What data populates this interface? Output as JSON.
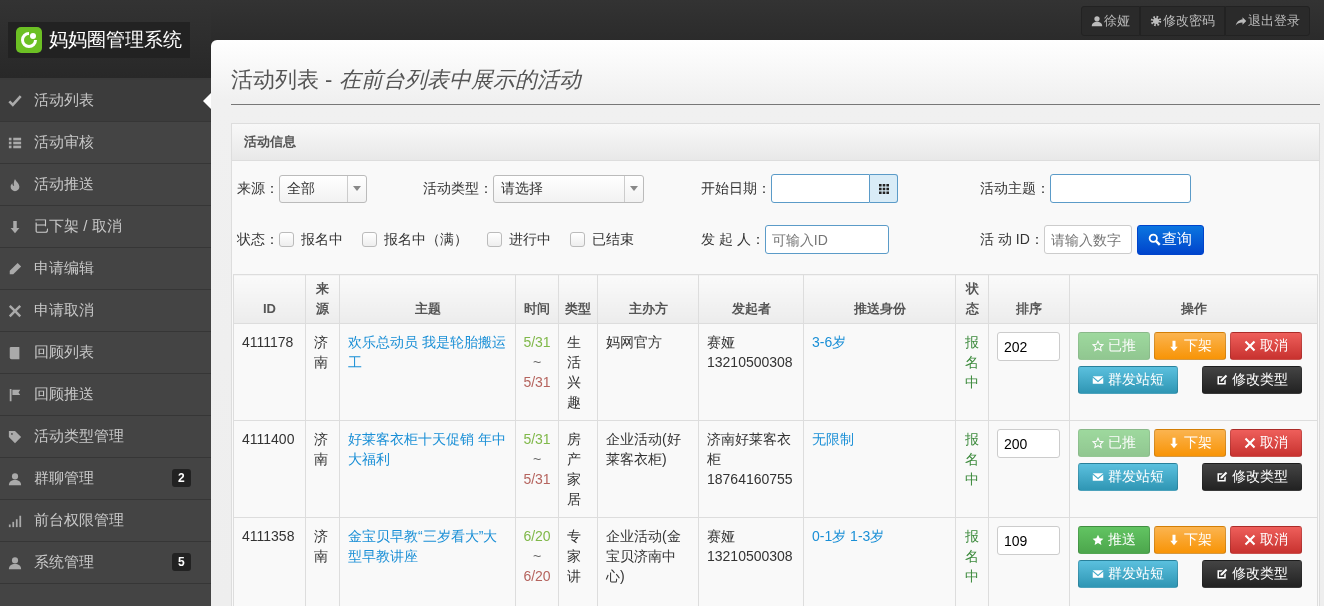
{
  "app": {
    "title": "妈妈圈管理系统"
  },
  "top_bar": {
    "buttons": [
      {
        "label": "徐娅"
      },
      {
        "label": "修改密码"
      },
      {
        "label": "退出登录"
      }
    ]
  },
  "sidebar": {
    "items": [
      {
        "label": "活动列表",
        "selected": true
      },
      {
        "label": "活动审核",
        "selected": false
      },
      {
        "label": "活动推送",
        "selected": false
      },
      {
        "label": "已下架 / 取消",
        "selected": false
      },
      {
        "label": "申请编辑",
        "selected": false
      },
      {
        "label": "申请取消",
        "selected": false
      },
      {
        "label": "回顾列表",
        "selected": false
      },
      {
        "label": "回顾推送",
        "selected": false
      },
      {
        "label": "活动类型管理",
        "selected": false
      },
      {
        "label": "群聊管理",
        "selected": false,
        "badge": "2"
      },
      {
        "label": "前台权限管理",
        "selected": false
      },
      {
        "label": "系统管理",
        "selected": false,
        "badge": "5"
      }
    ]
  },
  "page_header": "活动列表 - *在前台列表中展示的活动*",
  "panel": {
    "title": "活动信息",
    "filters": {
      "source": {
        "label": "来源：",
        "value": "全部"
      },
      "type": {
        "label": "活动类型：",
        "value": "请选择"
      },
      "start_date": {
        "label": "开始日期："
      },
      "subject": {
        "label": "活动主题："
      },
      "status": {
        "label": "状态：",
        "options": [
          {
            "label": "报名中",
            "checked": false
          },
          {
            "label": "报名中（满）",
            "checked": false
          },
          {
            "label": "进行中",
            "checked": false
          },
          {
            "label": "已结束",
            "checked": false
          }
        ]
      },
      "initiator": {
        "label": "发 起 人：",
        "placeholder": "可输入ID"
      },
      "activity_id": {
        "label": "活 动 ID：",
        "placeholder": "请输入数字"
      },
      "search_button": "查询"
    },
    "table": {
      "columns": [
        "ID",
        "来源",
        "主题",
        "时间",
        "类型",
        "主办方",
        "发起者",
        "推送身份",
        "状态",
        "排序",
        "操作"
      ],
      "rows": [
        {
          "id": "4111178",
          "source": "济南",
          "subject": "欢乐总动员 我是轮胎搬运工",
          "start": "5/31",
          "separator": "~",
          "end": "5/31",
          "type": "生活兴趣",
          "organizer": "妈网官方",
          "initiator": "赛娅",
          "phone": "13210500308",
          "audience": "3-6岁",
          "status": "报名中",
          "order": "202",
          "actions": [
            {
              "kind": "push",
              "label": "已推",
              "disabled": true
            },
            {
              "kind": "unlist",
              "label": "下架",
              "disabled": false
            },
            {
              "kind": "cancel",
              "label": "取消",
              "disabled": false
            },
            {
              "kind": "message",
              "label": "群发站短",
              "disabled": false
            },
            {
              "kind": "edit",
              "label": "修改类型",
              "disabled": false
            }
          ]
        },
        {
          "id": "4111400",
          "source": "济南",
          "subject": "好莱客衣柜十天促销 年中大福利",
          "start": "5/31",
          "separator": "~",
          "end": "5/31",
          "type": "房产家居",
          "organizer": "企业活动(好莱客衣柜)",
          "initiator": "济南好莱客衣柜",
          "phone": "18764160755",
          "audience": "无限制",
          "status": "报名中",
          "order": "200",
          "actions": [
            {
              "kind": "push",
              "label": "已推",
              "disabled": true
            },
            {
              "kind": "unlist",
              "label": "下架",
              "disabled": false
            },
            {
              "kind": "cancel",
              "label": "取消",
              "disabled": false
            },
            {
              "kind": "message",
              "label": "群发站短",
              "disabled": false
            },
            {
              "kind": "edit",
              "label": "修改类型",
              "disabled": false
            }
          ]
        },
        {
          "id": "4111358",
          "source": "济南",
          "subject": "金宝贝早教“三岁看大”大型早教讲座",
          "start": "6/20",
          "separator": "~",
          "end": "6/20",
          "type": "专家讲",
          "organizer": "企业活动(金宝贝济南中心)",
          "initiator": "赛娅",
          "phone": "13210500308",
          "audience": "0-1岁 1-3岁",
          "status": "报名中",
          "order": "109",
          "actions": [
            {
              "kind": "push",
              "label": "推送",
              "disabled": false
            },
            {
              "kind": "unlist",
              "label": "下架",
              "disabled": false
            },
            {
              "kind": "cancel",
              "label": "取消",
              "disabled": false
            },
            {
              "kind": "message",
              "label": "群发站短",
              "disabled": false
            },
            {
              "kind": "edit",
              "label": "修改类型",
              "disabled": false
            }
          ]
        }
      ]
    }
  }
}
